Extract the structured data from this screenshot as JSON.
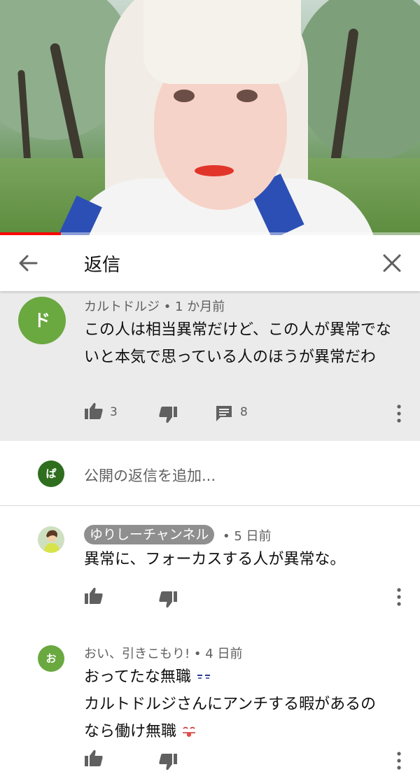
{
  "video": {
    "progress": 0.145
  },
  "header": {
    "title": "返信"
  },
  "parent_comment": {
    "avatar_letter": "ド",
    "avatar_color": "#6aa840",
    "meta": "カルトドルジ • 1 か月前",
    "text": "この人は相当異常だけど、この人が異常でないと本気で思っている人のほうが異常だわ",
    "likes": "3",
    "replies": "8"
  },
  "reply_box": {
    "avatar_letter": "ぱ",
    "avatar_color": "#2e6e1e",
    "placeholder": "公開の返信を追加..."
  },
  "replies": [
    {
      "author": "ゆりしーチャンネル",
      "time": " • 5 日前",
      "text": "異常に、フォーカスする人が異常な。"
    },
    {
      "avatar_letter": "お",
      "avatar_color": "#6aa840",
      "meta": "おい、引きこもり! • 4 日前",
      "line1": "おってたな無職",
      "line2": "カルトドルジさんにアンチする暇があるの",
      "line3": "なら働け無職"
    }
  ]
}
